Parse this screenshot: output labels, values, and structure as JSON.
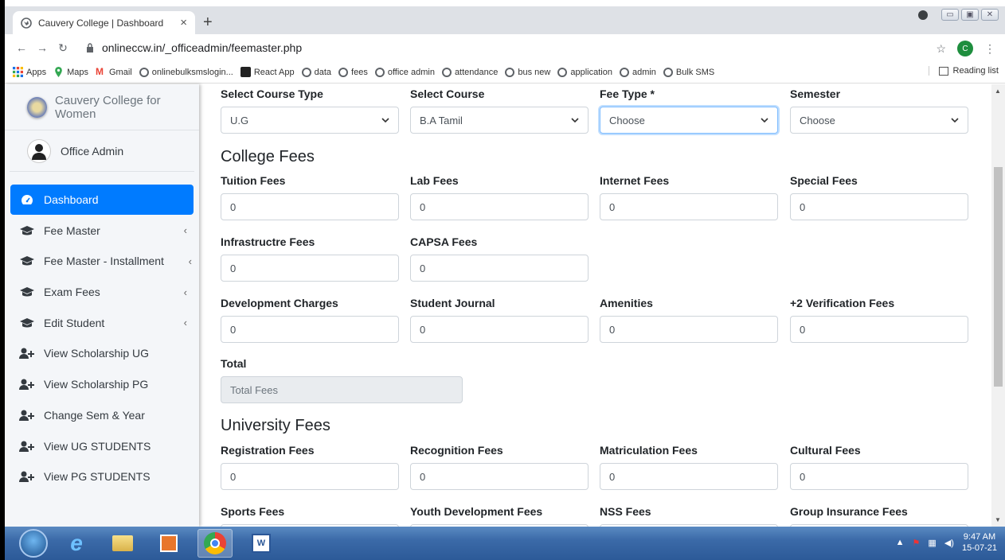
{
  "browser": {
    "tab_title": "Cauvery College | Dashboard",
    "new_tab": "+",
    "url": "onlineccw.in/_officeadmin/feemaster.php",
    "profile_initial": "C",
    "bookmarks": [
      "Apps",
      "Maps",
      "Gmail",
      "onlinebulksmslogin...",
      "React App",
      "data",
      "fees",
      "office admin",
      "attendance",
      "bus new",
      "application",
      "admin",
      "Bulk SMS"
    ],
    "reading_list": "Reading list"
  },
  "sidebar": {
    "brand": "Cauvery College for Women",
    "user": "Office Admin",
    "items": [
      {
        "label": "Dashboard",
        "icon": "dashboard-icon",
        "active": true,
        "chev": ""
      },
      {
        "label": "Fee Master",
        "icon": "graduation-cap-icon",
        "chev": "‹"
      },
      {
        "label": "Fee Master - Installment",
        "icon": "graduation-cap-icon",
        "chev": "‹"
      },
      {
        "label": "Exam Fees",
        "icon": "graduation-cap-icon",
        "chev": "‹"
      },
      {
        "label": "Edit Student",
        "icon": "graduation-cap-icon",
        "chev": "‹"
      },
      {
        "label": "View Scholarship UG",
        "icon": "user-plus-icon",
        "chev": ""
      },
      {
        "label": "View Scholarship PG",
        "icon": "user-plus-icon",
        "chev": ""
      },
      {
        "label": "Change Sem & Year",
        "icon": "user-plus-icon",
        "chev": ""
      },
      {
        "label": "View UG STUDENTS",
        "icon": "user-plus-icon",
        "chev": ""
      },
      {
        "label": "View PG STUDENTS",
        "icon": "user-plus-icon",
        "chev": ""
      }
    ]
  },
  "form": {
    "selects": {
      "course_type": {
        "label": "Select Course Type",
        "value": "U.G"
      },
      "course": {
        "label": "Select Course",
        "value": "B.A Tamil"
      },
      "fee_type": {
        "label": "Fee Type *",
        "value": "Choose"
      },
      "semester": {
        "label": "Semester",
        "value": "Choose"
      }
    },
    "college_title": "College Fees",
    "college": {
      "tuition": {
        "label": "Tuition Fees",
        "value": "0"
      },
      "lab": {
        "label": "Lab Fees",
        "value": "0"
      },
      "internet": {
        "label": "Internet Fees",
        "value": "0"
      },
      "special": {
        "label": "Special Fees",
        "value": "0"
      },
      "infra": {
        "label": "Infrastructre Fees",
        "value": "0"
      },
      "capsa": {
        "label": "CAPSA Fees",
        "value": "0"
      },
      "development": {
        "label": "Development Charges",
        "value": "0"
      },
      "journal": {
        "label": "Student Journal",
        "value": "0"
      },
      "amenities": {
        "label": "Amenities",
        "value": "0"
      },
      "verification": {
        "label": "+2 Verification Fees",
        "value": "0"
      }
    },
    "total": {
      "label": "Total",
      "placeholder": "Total Fees"
    },
    "university_title": "University Fees",
    "university": {
      "registration": {
        "label": "Registration Fees",
        "value": "0"
      },
      "recognition": {
        "label": "Recognition Fees",
        "value": "0"
      },
      "matriculation": {
        "label": "Matriculation Fees",
        "value": "0"
      },
      "cultural": {
        "label": "Cultural Fees",
        "value": "0"
      },
      "sports": {
        "label": "Sports Fees"
      },
      "youth": {
        "label": "Youth Development Fees"
      },
      "nss": {
        "label": "NSS Fees"
      },
      "insurance": {
        "label": "Group Insurance Fees"
      }
    }
  },
  "taskbar": {
    "time": "9:47 AM",
    "date": "15-07-21"
  }
}
